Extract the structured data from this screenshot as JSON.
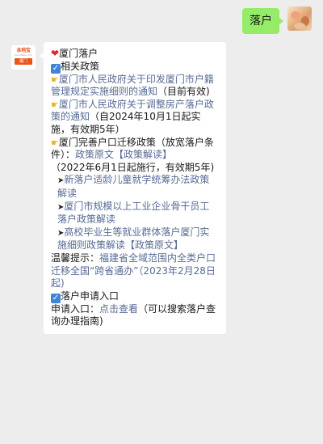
{
  "outgoing": {
    "text": "落户"
  },
  "account": {
    "logo_name": "本地宝",
    "logo_sub": "bendibao.com",
    "logo_city": "厦门"
  },
  "reply": {
    "title": "厦门落户",
    "section_policy": "相关政策",
    "item1_link": "厦门市人民政府关于印发厦门市户籍管理规定实施细则的通知",
    "item1_note": "（目前有效)",
    "item2_link": "厦门市人民政府关于调整房产落户政策的通知",
    "item2_note": "（自2024年10月1日起实施，有效期5年）",
    "item3_text": "厦门完善户口迁移政策（放宽落户条件）：",
    "item3_link1": "政策原文",
    "item3_link2": "【政策解读】",
    "item3_note": "（2022年6月1日起施行，有效期5年)",
    "sub1": "新落户适龄儿童就学统筹办法政策解读",
    "sub2": "厦门市规模以上工业企业骨干员工落户政策解读",
    "sub3": "高校毕业生等就业群体落户厦门实施细则政策解读",
    "sub3_link2": "【政策原文】",
    "tip_label": "温馨提示：",
    "tip_link": "福建省全域范围内全类户口迁移全国“跨省通办”（2023年2月28日起)",
    "section_apply": "落户申请入口",
    "apply_label": "申请入口：",
    "apply_link": "点击查看",
    "apply_note": "（可以搜索落户查询办理指南)"
  },
  "icons": [
    "heart-icon",
    "check-icon",
    "hand-point-icon",
    "arrow-icon"
  ],
  "colors": {
    "outgoing_bubble": "#95ec69",
    "link": "#576b95",
    "background": "#ededed"
  }
}
